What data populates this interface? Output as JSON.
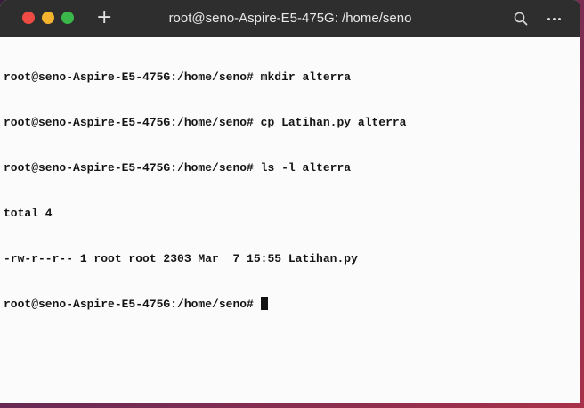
{
  "window": {
    "title": "root@seno-Aspire-E5-475G: /home/seno",
    "new_tab_label": "+"
  },
  "terminal": {
    "lines": [
      {
        "prompt": "root@seno-Aspire-E5-475G:/home/seno#",
        "command": " mkdir alterra"
      },
      {
        "prompt": "root@seno-Aspire-E5-475G:/home/seno#",
        "command": " cp Latihan.py alterra"
      },
      {
        "prompt": "root@seno-Aspire-E5-475G:/home/seno#",
        "command": " ls -l alterra"
      },
      {
        "output": "total 4"
      },
      {
        "output": "-rw-r--r-- 1 root root 2303 Mar  7 15:55 Latihan.py"
      },
      {
        "prompt": "root@seno-Aspire-E5-475G:/home/seno#",
        "command": " "
      }
    ]
  },
  "icons": {
    "search": "search-icon",
    "menu": "more-options-icon",
    "close": "close-dot",
    "minimize": "minimize-dot",
    "maximize": "maximize-dot"
  },
  "colors": {
    "close": "#ee4b44",
    "minimize": "#f3b32f",
    "maximize": "#3bb84a",
    "titlebar": "#2e2e2e",
    "terminal_bg": "#fbfbfb",
    "text": "#141414"
  }
}
